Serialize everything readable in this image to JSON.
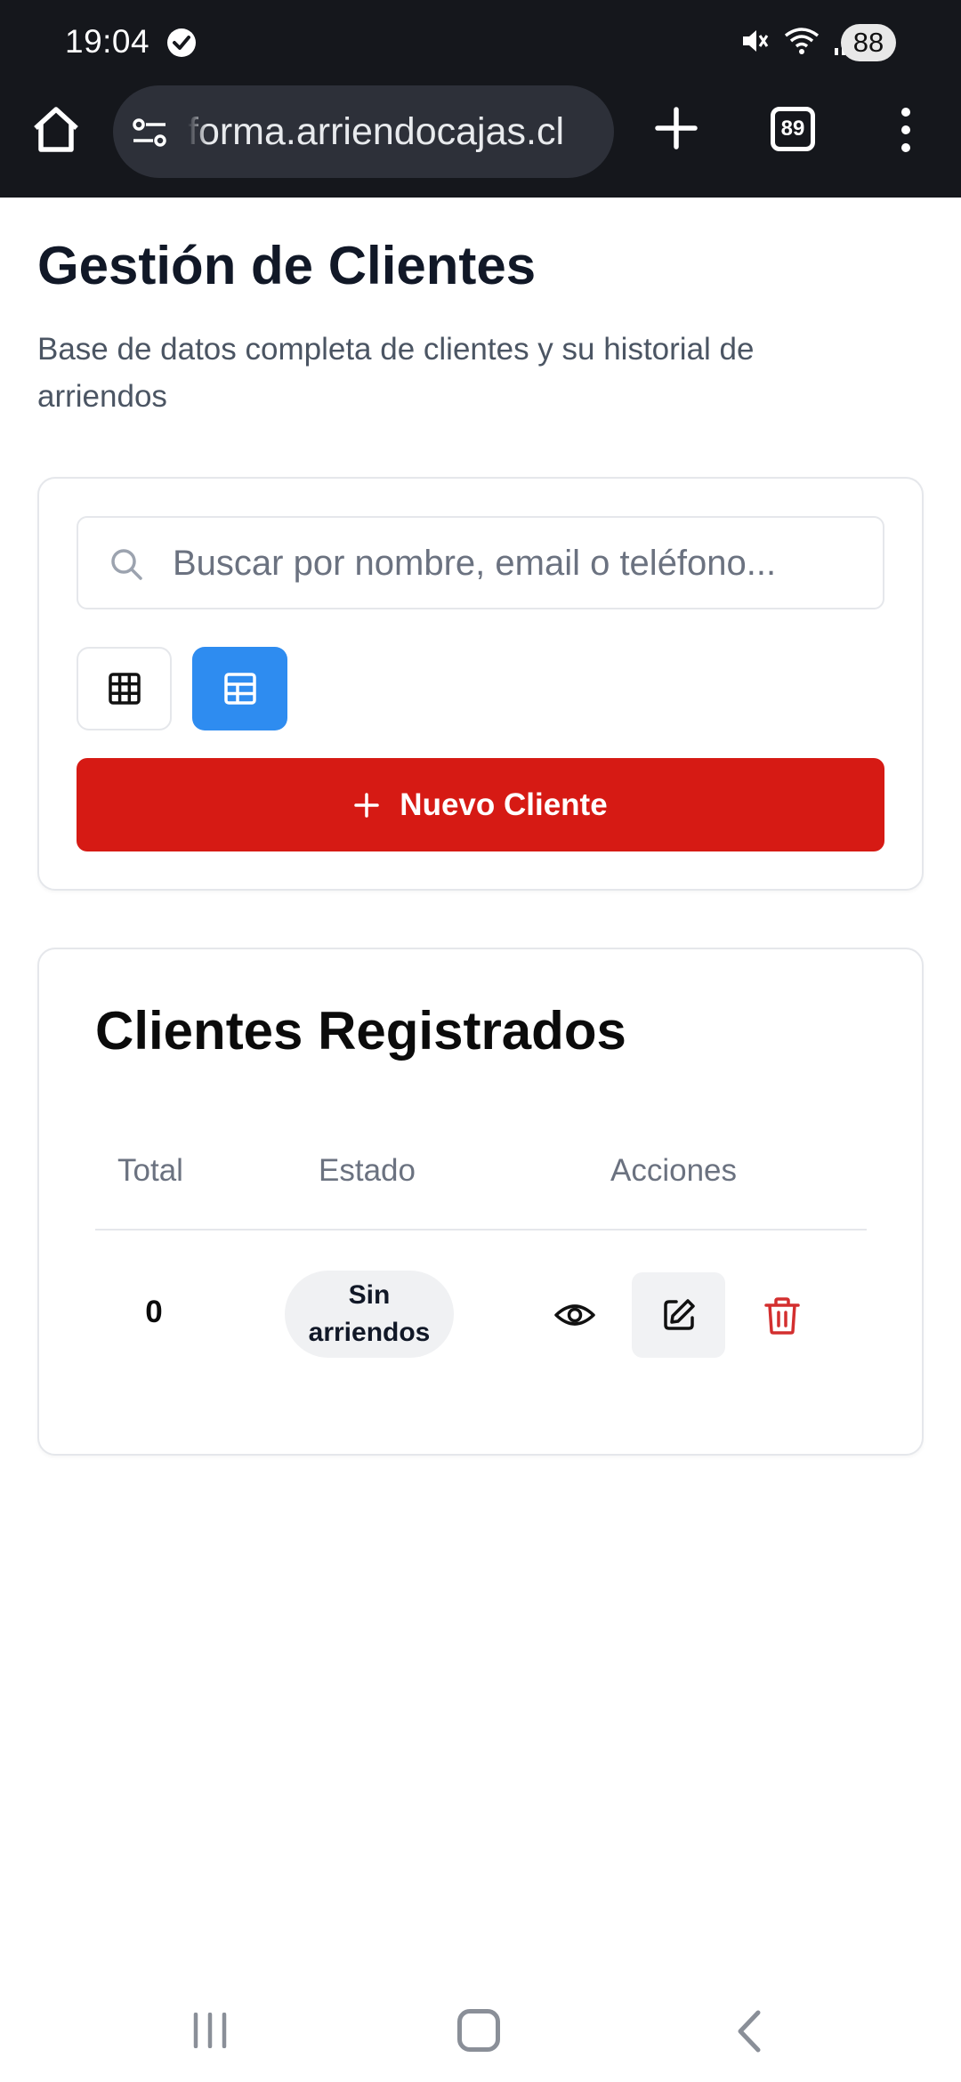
{
  "status_bar": {
    "time": "19:04",
    "battery": "88",
    "icons": [
      "check-circle-icon",
      "mute-icon",
      "wifi-icon",
      "signal-icon"
    ]
  },
  "browser": {
    "url": "forma.arriendocajas.cl",
    "tab_count": "89"
  },
  "page": {
    "title": "Gestión de Clientes",
    "description": "Base de datos completa de clientes y su historial de arriendos"
  },
  "filters": {
    "search_placeholder": "Buscar por nombre, email o teléfono...",
    "view_modes": [
      "grid",
      "table"
    ],
    "active_view": "table",
    "new_client_label": "Nuevo Cliente"
  },
  "table": {
    "title": "Clientes Registrados",
    "columns": [
      "Total",
      "Estado",
      "Acciones"
    ],
    "rows": [
      {
        "total": "0",
        "estado": "Sin arriendos",
        "actions": [
          "view-icon",
          "edit-icon",
          "delete-icon"
        ]
      }
    ]
  },
  "colors": {
    "primary_red": "#d61a14",
    "active_blue": "#2e8cf0",
    "delete_red": "#d32f2f"
  }
}
